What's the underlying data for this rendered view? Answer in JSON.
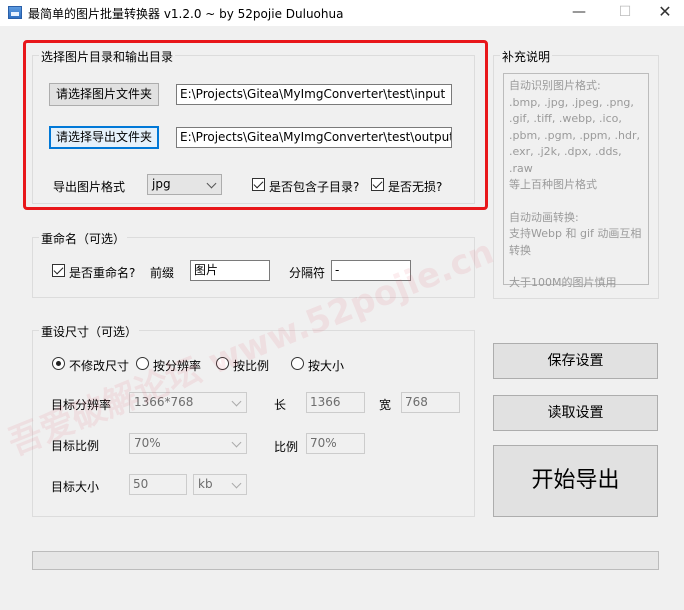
{
  "window": {
    "title": "最简单的图片批量转换器 v1.2.0 ~ by 52pojie Duluohua",
    "minimize_glyph": "—",
    "maximize_glyph": "☐",
    "close_glyph": "✕"
  },
  "dirs": {
    "group_title": "选择图片目录和输出目录",
    "input_button": "请选择图片文件夹",
    "input_path": "E:\\Projects\\Gitea\\MyImgConverter\\test\\input",
    "output_button": "请选择导出文件夹",
    "output_path": "E:\\Projects\\Gitea\\MyImgConverter\\test\\output",
    "format_label": "导出图片格式",
    "format_value": "jpg",
    "include_subdirs_label": "是否包含子目录?",
    "include_subdirs_checked": true,
    "lossless_label": "是否无损?",
    "lossless_checked": true
  },
  "rename": {
    "group_title": "重命名（可选）",
    "enable_label": "是否重命名?",
    "enable_checked": true,
    "prefix_label": "前缀",
    "prefix_value": "图片",
    "separator_label": "分隔符",
    "separator_value": "-"
  },
  "resize": {
    "group_title": "重设尺寸（可选）",
    "options": [
      "不修改尺寸",
      "按分辨率",
      "按比例",
      "按大小"
    ],
    "selected_option": "不修改尺寸",
    "target_resolution_label": "目标分辨率",
    "target_resolution_value": "1366*768",
    "length_label": "长",
    "length_value": "1366",
    "width_label": "宽",
    "width_value": "768",
    "target_ratio_label": "目标比例",
    "target_ratio_value": "70%",
    "ratio_label": "比例",
    "ratio_value": "70%",
    "target_size_label": "目标大小",
    "target_size_value": "50",
    "size_unit_value": "kb"
  },
  "notes": {
    "group_title": "补充说明",
    "paragraphs": [
      "自动识别图片格式:\n.bmp, .jpg, .jpeg, .png,\n.gif, .tiff, .webp, .ico,\n.pbm, .pgm, .ppm, .hdr,\n.exr, .j2k, .dpx, .dds, .raw\n等上百种图片格式",
      "自动动画转换:\n支持Webp 和 gif 动画互相转换",
      "大于100M的图片慎用"
    ]
  },
  "actions": {
    "save_label": "保存设置",
    "load_label": "读取设置",
    "start_label": "开始导出"
  },
  "progress": {
    "value": 0
  },
  "watermark": {
    "text": "吾爱破解论坛 www.52pojie.cn"
  }
}
